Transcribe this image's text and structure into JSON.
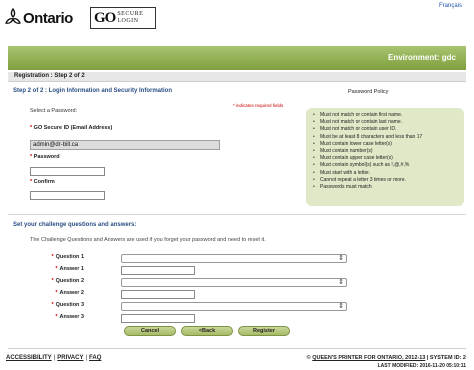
{
  "header": {
    "ontario_logo": "Ontario",
    "go_secure_logo": {
      "go": "GO",
      "line1": "SECURE",
      "line2": "LOGIN"
    },
    "language_link": "Français"
  },
  "banner": {
    "environment": "Environment: gdc",
    "color": "#8fae4f"
  },
  "registration": {
    "title": "Registration : Step 2 of 2"
  },
  "login_section": {
    "title": "Step 2 of 2 : Login Information and Security Information",
    "required_note": "* indicates required fields",
    "select_password": "Select a Password:",
    "id_label": "GO Secure ID (Email Address)",
    "id_value": "admin@dr-bill.ca",
    "password_label": "Password",
    "confirm_label": "Confirm",
    "required_mark": "*"
  },
  "policy": {
    "title": "Password Policy",
    "box_color": "#dfe8c7",
    "rules": [
      "Must not match or contain first name.",
      "Must not match or contain last name.",
      "Must not match or contain user ID.",
      "Must be at least 8 characters and less than 17",
      "Must contain lower case letter(s)",
      "Must contain number(s)",
      "Must contain upper case letter(s)",
      "Must contain symbol(s) such as !,@,#,%",
      "Must start with a letter.",
      "Cannot repeat a letter 3 times or more.",
      "Passwords must match"
    ]
  },
  "challenge": {
    "title": "Set your challenge questions and answers:",
    "description": "The Challenge Questions and Answers are used if you forget your password and need to reset it.",
    "items": [
      {
        "question_label": "Question 1",
        "answer_label": "Answer 1"
      },
      {
        "question_label": "Question 2",
        "answer_label": "Answer 2"
      },
      {
        "question_label": "Question 3",
        "answer_label": "Answer 3"
      }
    ]
  },
  "buttons": {
    "cancel": "Cancel",
    "back": "<Back",
    "register": "Register"
  },
  "footer": {
    "accessibility": "ACCESSIBILITY",
    "privacy": "PRIVACY",
    "faq": "FAQ",
    "separator": "|",
    "copyright_prefix": "© ",
    "copyright_link": "QUEEN'S PRINTER FOR ONTARIO, 2012-13",
    "system_id": " | SYSTEM ID: 2",
    "last_modified": "LAST MODIFIED: 2016-11-20 05:10:11"
  }
}
